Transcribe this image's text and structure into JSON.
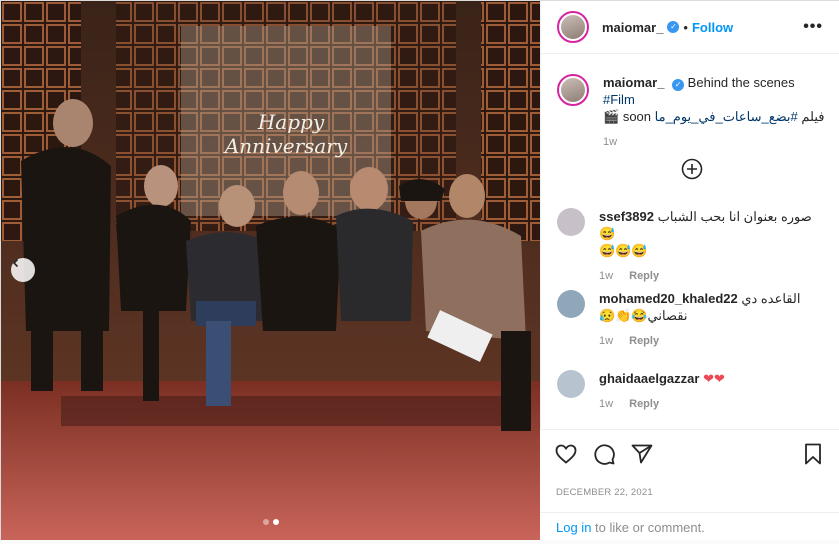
{
  "post": {
    "author": "maiomar_",
    "follow_label": "Follow",
    "separator": "•",
    "more_label": "•••"
  },
  "photo": {
    "neon_line1": "Happy",
    "neon_line2": "Anniversary",
    "slide_count": 2,
    "active_slide": 2
  },
  "caption": {
    "username": "maiomar_",
    "text_en": "Behind the scenes ",
    "hashtag1": "#Film",
    "text_line2_a": "soon",
    "text_line2_b": "فيلم ",
    "hashtag2": "#بضع_ساعات_في_يوم_ما",
    "time": "1w"
  },
  "comments": [
    {
      "username": "ssef3892",
      "text": "صوره بعنوان انا بحب الشباب 😅",
      "emojis": "😅😅😅",
      "time": "1w",
      "reply_label": "Reply",
      "avatar_color": "#c7c0c9"
    },
    {
      "username": "mohamed20_khaled22",
      "text": "القاعده دي",
      "text2": "نقصاني😂👏😥",
      "time": "1w",
      "reply_label": "Reply",
      "avatar_color": "#8fa7b8"
    },
    {
      "username": "ghaidaaelgazzar",
      "text": "❤❤",
      "time": "1w",
      "reply_label": "Reply",
      "avatar_color": "#b7c4cf"
    }
  ],
  "footer": {
    "date": "DECEMBER 22, 2021",
    "login_link": "Log in",
    "login_rest": " to like or comment."
  },
  "icons": [
    "chevron-left-icon",
    "plus-circle-icon",
    "heart-icon",
    "comment-icon",
    "share-icon",
    "bookmark-icon",
    "verified-icon"
  ]
}
